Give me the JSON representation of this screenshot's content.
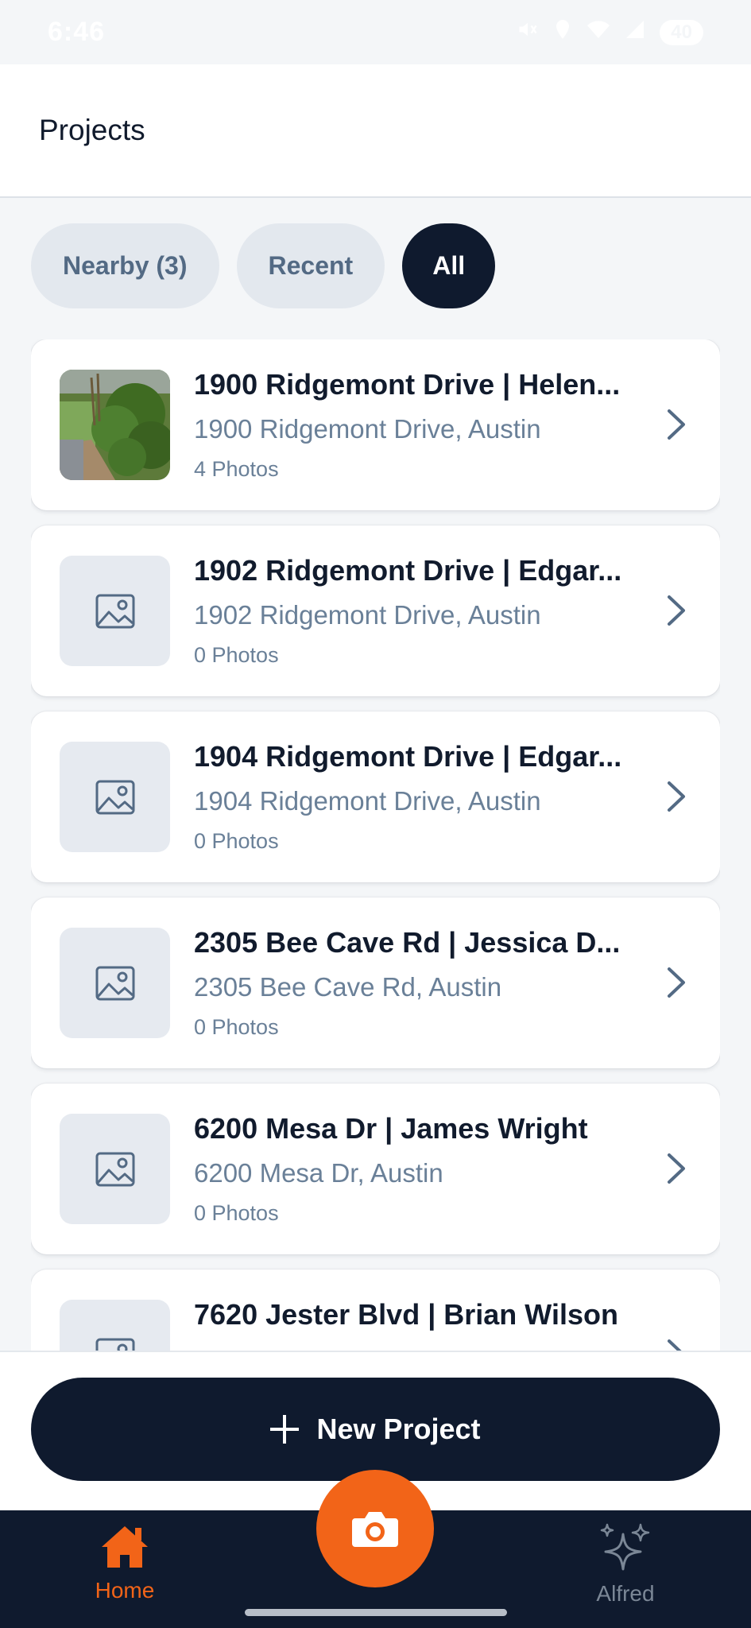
{
  "status_bar": {
    "time": "6:46",
    "battery": "40"
  },
  "header": {
    "title": "Projects"
  },
  "filters": [
    {
      "label": "Nearby (3)",
      "active": false
    },
    {
      "label": "Recent",
      "active": false
    },
    {
      "label": "All",
      "active": true
    }
  ],
  "projects": [
    {
      "title": "1900 Ridgemont Drive | Helen...",
      "address": "1900 Ridgemont Drive, Austin",
      "photos": "4 Photos",
      "has_photo": true
    },
    {
      "title": "1902 Ridgemont Drive | Edgar...",
      "address": "1902 Ridgemont Drive, Austin",
      "photos": "0 Photos",
      "has_photo": false
    },
    {
      "title": "1904 Ridgemont Drive | Edgar...",
      "address": "1904 Ridgemont Drive, Austin",
      "photos": "0 Photos",
      "has_photo": false
    },
    {
      "title": "2305 Bee Cave Rd | Jessica D...",
      "address": "2305 Bee Cave Rd, Austin",
      "photos": "0 Photos",
      "has_photo": false
    },
    {
      "title": "6200 Mesa Dr | James Wright",
      "address": "6200 Mesa Dr, Austin",
      "photos": "0 Photos",
      "has_photo": false
    },
    {
      "title": "7620 Jester Blvd | Brian Wilson",
      "address": "",
      "photos": "",
      "has_photo": false
    }
  ],
  "actions": {
    "new_project_label": "New Project"
  },
  "tab_bar": {
    "home_label": "Home",
    "alfred_label": "Alfred"
  },
  "colors": {
    "accent": "#f26418",
    "dark": "#0f1a2e",
    "muted": "#6a8098"
  },
  "icons": {
    "placeholder": "image-icon",
    "chevron": "chevron-right-icon",
    "camera": "camera-icon",
    "home": "home-icon",
    "alfred": "sparkles-icon"
  }
}
